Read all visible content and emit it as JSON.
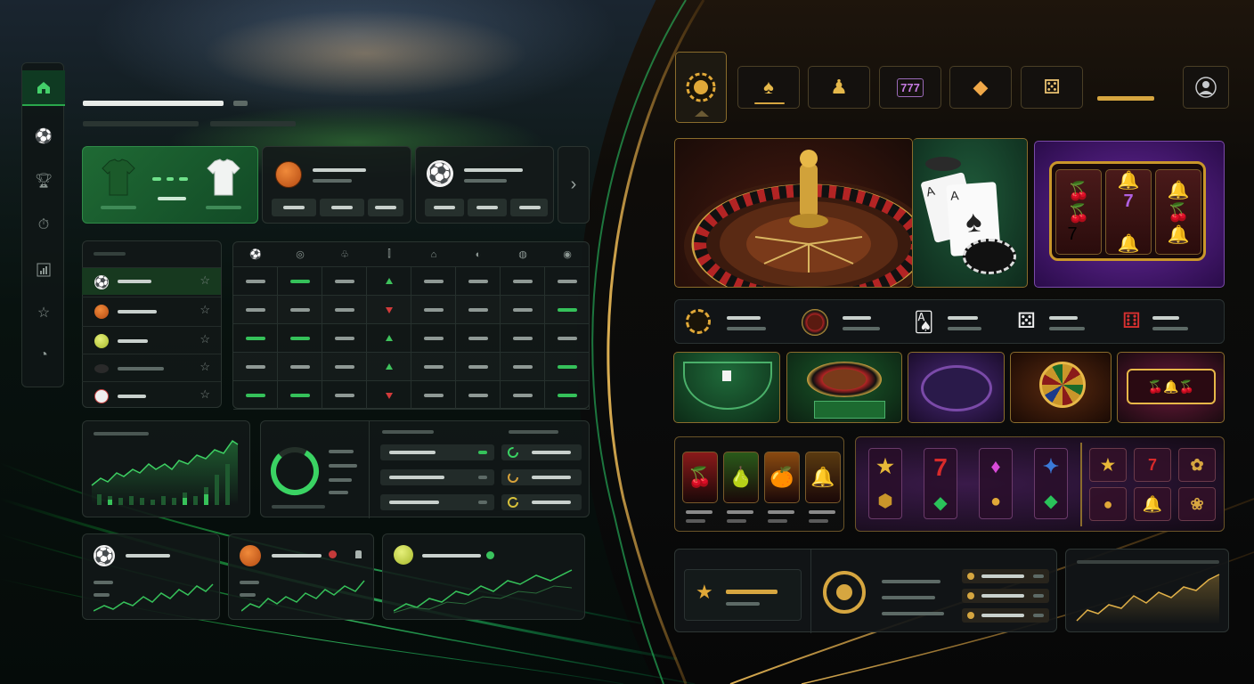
{
  "colors": {
    "sport_accent": "#35c15a",
    "casino_accent": "#d6a640",
    "odds_down": "#d23b3b"
  },
  "sidebar": {
    "items": [
      {
        "icon": "home-icon",
        "active": true
      },
      {
        "icon": "soccer-ball-icon"
      },
      {
        "icon": "trophy-icon"
      },
      {
        "icon": "stopwatch-icon"
      },
      {
        "icon": "stats-chart-icon"
      },
      {
        "icon": "star-icon"
      },
      {
        "icon": "gauge-icon"
      }
    ]
  },
  "featured_matches": [
    {
      "type": "soccer",
      "icons": [
        "green-jersey-icon",
        "white-jersey-icon"
      ],
      "active": true
    },
    {
      "type": "basketball",
      "icon": "basketball-icon"
    },
    {
      "type": "soccer",
      "icon": "soccer-ball-icon"
    }
  ],
  "featured_next_icon": "chevron-right-icon",
  "sport_list": [
    {
      "icon": "soccer-ball-icon",
      "active": true
    },
    {
      "icon": "basketball-icon"
    },
    {
      "icon": "tennis-icon"
    },
    {
      "icon": "hockey-puck-icon"
    },
    {
      "icon": "baseball-icon"
    }
  ],
  "odds_grid": {
    "header_icons": [
      "soccer-ball-icon",
      "volleyball-icon",
      "tennis-icon",
      "stats-icon",
      "hockey-icon",
      "baseball-icon",
      "rugby-icon",
      "table-tennis-icon"
    ],
    "rows": [
      [
        "dim",
        "g",
        "dim",
        "up",
        "dim",
        "dim",
        "dim",
        "dim"
      ],
      [
        "dim",
        "dim",
        "dim",
        "down",
        "dim",
        "dim",
        "dim",
        "g"
      ],
      [
        "g",
        "g",
        "dim",
        "up",
        "dim",
        "dim",
        "dim",
        "dim"
      ],
      [
        "dim",
        "dim",
        "dim",
        "up",
        "dim",
        "dim",
        "dim",
        "g"
      ],
      [
        "g",
        "g",
        "dim",
        "down",
        "dim",
        "dim",
        "dim",
        "g"
      ]
    ]
  },
  "mini_charts": [
    {
      "icon": "soccer-ball-icon"
    },
    {
      "icon": "basketball-icon"
    },
    {
      "icon": "tennis-icon"
    }
  ],
  "casino": {
    "categories": [
      {
        "icon": "poker-chip-icon",
        "symbol": "◉",
        "active": true
      },
      {
        "icon": "spade-icon",
        "symbol": "♠"
      },
      {
        "icon": "live-dealer-icon",
        "symbol": "♟"
      },
      {
        "icon": "slot-machine-icon",
        "symbol": "777"
      },
      {
        "icon": "diamond-icon",
        "symbol": "◆"
      },
      {
        "icon": "dice-icon",
        "symbol": "⚄"
      }
    ],
    "profile_icon": "user-profile-icon",
    "hero_tiles": [
      {
        "name": "roulette",
        "icon": "roulette-wheel-icon"
      },
      {
        "name": "blackjack",
        "icon": "playing-cards-icon",
        "cards": [
          "A",
          "A"
        ]
      },
      {
        "name": "slots",
        "icon": "slot-reels-icon"
      }
    ],
    "game_types": [
      {
        "icon": "poker-chip-icon"
      },
      {
        "icon": "roulette-icon"
      },
      {
        "icon": "cards-icon"
      },
      {
        "icon": "dice-white-icon"
      },
      {
        "icon": "dice-red-icon"
      }
    ],
    "tables": [
      {
        "name": "blackjack-table"
      },
      {
        "name": "roulette-table"
      },
      {
        "name": "poker-table"
      },
      {
        "name": "wheel-of-fortune"
      },
      {
        "name": "slot-cabinet"
      }
    ],
    "slot_reels_left": [
      "🍒",
      "🍐",
      "🍊",
      "🔔"
    ],
    "slot_symbols_center": [
      {
        "top": "★",
        "bottom": "⬢"
      },
      {
        "top": "7",
        "bottom": "◆"
      },
      {
        "top": "♦",
        "bottom": "●"
      },
      {
        "top": "✦",
        "bottom": "◆"
      }
    ],
    "slot_symbols_right": [
      "★",
      "7",
      "✿",
      "●",
      "🔔",
      "❀"
    ],
    "jackpot_icon": "star-icon",
    "target_icon": "target-icon"
  }
}
